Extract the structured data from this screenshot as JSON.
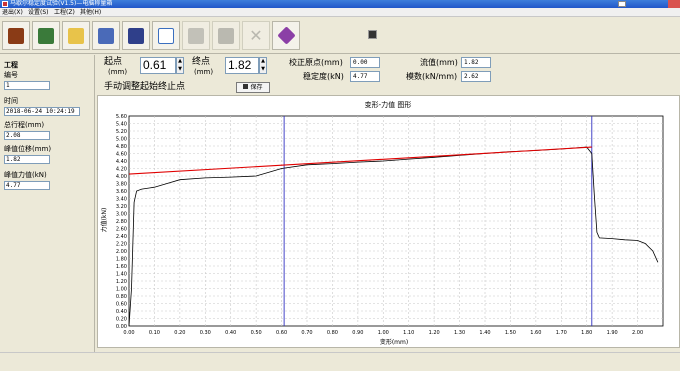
{
  "window": {
    "title": "马歇尔稳定度试验(V1.5)—电脑称量箱"
  },
  "menu": {
    "items": [
      "退出(X)",
      "设置(S)",
      "工程(Z)",
      "其他(H)"
    ]
  },
  "toolbar": {
    "buttons": [
      {
        "name": "exit-icon",
        "color": "#8a3b16"
      },
      {
        "name": "settings-icon",
        "color": "#3a7a3a"
      },
      {
        "name": "folder-icon",
        "color": "#e8c34a"
      },
      {
        "name": "edit-icon",
        "color": "#4a6ab8"
      },
      {
        "name": "calculator-icon",
        "color": "#2f3f8a"
      },
      {
        "name": "chart-icon",
        "color": "#3b6fbf"
      },
      {
        "name": "stop-icon",
        "color": "#9a9a9a"
      },
      {
        "name": "scan-icon",
        "color": "#8a8a8a"
      },
      {
        "name": "close-icon",
        "color": "#9a9a9a"
      },
      {
        "name": "help-icon",
        "color": "#8b3fa6"
      }
    ]
  },
  "left_panel": {
    "project_label": "工程",
    "sample_no_label": "编号",
    "sample_no_value": "1",
    "time_label": "时间",
    "time_value": "2018-06-24 10:24:19",
    "total_travel_label": "总行程(mm)",
    "total_travel_value": "2.08",
    "peak_disp_label": "峰值位移(mm)",
    "peak_disp_value": "1.82",
    "peak_force_label": "峰值力值(kN)",
    "peak_force_value": "4.77"
  },
  "params": {
    "start_label": "起点",
    "start_unit": "(mm)",
    "start_value": "0.61",
    "end_label": "终点",
    "end_unit": "(mm)",
    "end_value": "1.82",
    "manual_label": "手动调整起始终止点",
    "save_label": "保存",
    "origin_label": "校正原点(mm)",
    "origin_value": "0.00",
    "stability_label": "稳定度(kN)",
    "stability_value": "4.77",
    "flow_label": "流值(mm)",
    "flow_value": "1.82",
    "modulus_label": "模数(kN/mm)",
    "modulus_value": "2.62"
  },
  "chart_data": {
    "type": "line",
    "title": "变形-力值 图形",
    "xlabel": "变形(mm)",
    "ylabel": "力值(kN)",
    "xlim": [
      0,
      2.1
    ],
    "ylim": [
      0,
      5.6
    ],
    "xticks": [
      "0.00",
      "0.10",
      "0.20",
      "0.30",
      "0.40",
      "0.50",
      "0.60",
      "0.70",
      "0.80",
      "0.90",
      "1.00",
      "1.10",
      "1.20",
      "1.30",
      "1.40",
      "1.50",
      "1.60",
      "1.70",
      "1.80",
      "1.90",
      "2.00"
    ],
    "yticks": [
      "0.00",
      "0.20",
      "0.40",
      "0.60",
      "0.80",
      "1.00",
      "1.20",
      "1.40",
      "1.60",
      "1.80",
      "2.00",
      "2.20",
      "2.40",
      "2.60",
      "2.80",
      "3.00",
      "3.20",
      "3.40",
      "3.60",
      "3.80",
      "4.00",
      "4.20",
      "4.40",
      "4.60",
      "4.80",
      "5.00",
      "5.20",
      "5.40",
      "5.60"
    ],
    "grid": true,
    "series": [
      {
        "color": "#000000",
        "x": [
          0.0,
          0.01,
          0.02,
          0.03,
          0.05,
          0.08,
          0.1,
          0.15,
          0.2,
          0.3,
          0.4,
          0.5,
          0.55,
          0.6,
          0.7,
          0.8,
          0.9,
          1.0,
          1.1,
          1.2,
          1.3,
          1.4,
          1.5,
          1.6,
          1.7,
          1.8,
          1.82,
          1.83,
          1.84,
          1.85,
          1.9,
          1.95,
          2.0,
          2.03,
          2.06,
          2.08
        ],
        "y": [
          0.0,
          1.0,
          3.3,
          3.6,
          3.65,
          3.68,
          3.7,
          3.8,
          3.9,
          3.95,
          3.97,
          4.0,
          4.1,
          4.2,
          4.3,
          4.33,
          4.37,
          4.4,
          4.45,
          4.5,
          4.55,
          4.6,
          4.65,
          4.68,
          4.72,
          4.77,
          4.6,
          3.5,
          2.5,
          2.35,
          2.33,
          2.3,
          2.28,
          2.2,
          2.0,
          1.7
        ]
      },
      {
        "color": "#e00000",
        "x": [
          0.0,
          1.82
        ],
        "y": [
          4.05,
          4.77
        ]
      }
    ],
    "markers": [
      {
        "x": 0.61,
        "color": "#3030c0"
      },
      {
        "x": 1.82,
        "color": "#3030c0"
      }
    ]
  }
}
